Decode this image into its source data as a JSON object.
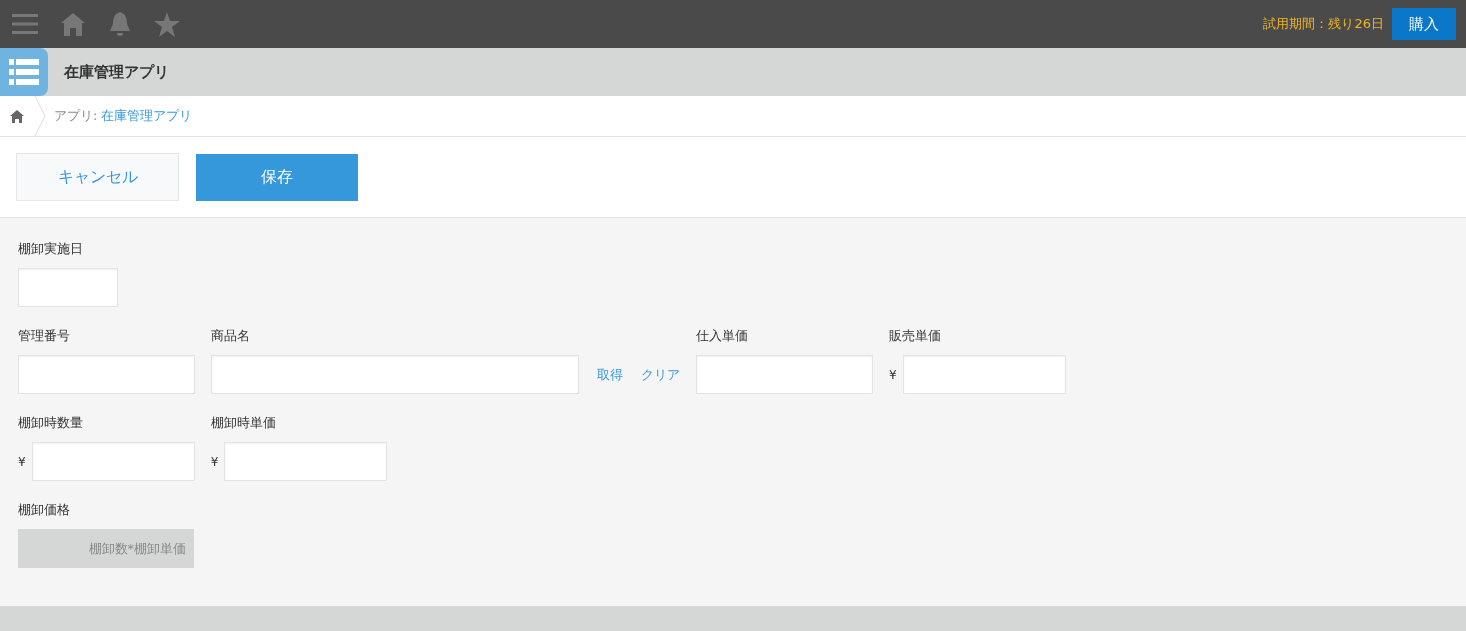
{
  "trial": {
    "text": "試用期間：残り26日",
    "button": "購入"
  },
  "app": {
    "title": "在庫管理アプリ"
  },
  "breadcrumb": {
    "prefix": "アプリ:",
    "link": "在庫管理アプリ"
  },
  "actions": {
    "cancel": "キャンセル",
    "save": "保存"
  },
  "rows": [
    [
      {
        "kind": "date",
        "label": "棚卸実施日"
      }
    ],
    [
      {
        "kind": "text",
        "label": "管理番号"
      },
      {
        "kind": "lookup",
        "label": "商品名",
        "links": [
          "取得",
          "クリア"
        ]
      },
      {
        "kind": "text",
        "label": "仕入単価"
      },
      {
        "kind": "text",
        "label": "販売単価",
        "prefix": "¥"
      }
    ],
    [
      {
        "kind": "text",
        "label": "棚卸時数量",
        "prefix": "¥"
      },
      {
        "kind": "text",
        "label": "棚卸時単価",
        "prefix": "¥"
      }
    ],
    [
      {
        "kind": "calc",
        "label": "棚卸価格",
        "value": "棚卸数*棚卸単価"
      }
    ]
  ]
}
